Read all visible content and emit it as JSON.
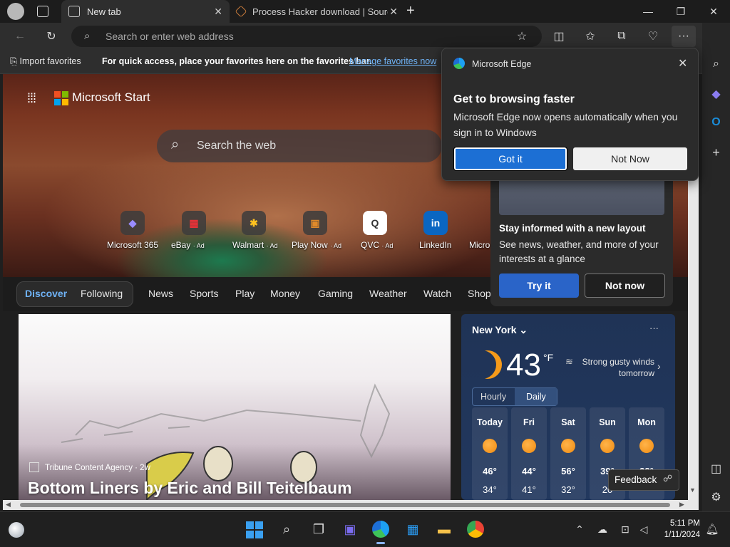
{
  "tabs": [
    {
      "title": "New tab"
    },
    {
      "title": "Process Hacker download | Sourc"
    }
  ],
  "address_bar": {
    "placeholder": "Search or enter web address"
  },
  "favorites_bar": {
    "import_label": "Import favorites",
    "hint": "For quick access, place your favorites here on the favorites bar.",
    "link": "Manage favorites now"
  },
  "popup": {
    "app_name": "Microsoft Edge",
    "title": "Get to browsing faster",
    "body": "Microsoft Edge now opens automatically when you sign in to Windows",
    "primary_button": "Got it",
    "secondary_button": "Not Now"
  },
  "start_page": {
    "brand": "Microsoft Start",
    "search_placeholder": "Search the web",
    "quick_links": [
      {
        "label": "Microsoft 365",
        "ad": ""
      },
      {
        "label": "eBay",
        "ad": "· Ad"
      },
      {
        "label": "Walmart",
        "ad": "· Ad"
      },
      {
        "label": "Play Now",
        "ad": "· Ad"
      },
      {
        "label": "QVC",
        "ad": "· Ad"
      },
      {
        "label": "LinkedIn",
        "ad": ""
      },
      {
        "label": "Micro",
        "ad": ""
      }
    ],
    "nav": [
      "Discover",
      "Following",
      "News",
      "Sports",
      "Play",
      "Money",
      "Gaming",
      "Weather",
      "Watch",
      "Shop"
    ],
    "news": {
      "source": "Tribune Content Agency · 2w",
      "title": "Bottom Liners by Eric and Bill Teitelbaum"
    },
    "layout_promo": {
      "title": "Stay informed with a new layout",
      "body": "See news, weather, and more of your interests at a glance",
      "try_button": "Try it",
      "dismiss_button": "Not now"
    },
    "feedback_label": "Feedback"
  },
  "weather": {
    "city": "New York",
    "temp": "43",
    "unit": "°F",
    "alert": "Strong gusty winds tomorrow",
    "tabs": [
      "Hourly",
      "Daily"
    ],
    "days": [
      {
        "name": "Today",
        "high": "46°",
        "low": "34°"
      },
      {
        "name": "Fri",
        "high": "44°",
        "low": "41°"
      },
      {
        "name": "Sat",
        "high": "56°",
        "low": "32°"
      },
      {
        "name": "Sun",
        "high": "39°",
        "low": "20"
      },
      {
        "name": "Mon",
        "high": "38°",
        "low": ""
      }
    ]
  },
  "taskbar": {
    "time": "5:11 PM",
    "date": "1/11/2024"
  },
  "colors": {
    "accent": "#1c6fd4",
    "link": "#6fb2f5",
    "sun": "#f59a1a"
  }
}
